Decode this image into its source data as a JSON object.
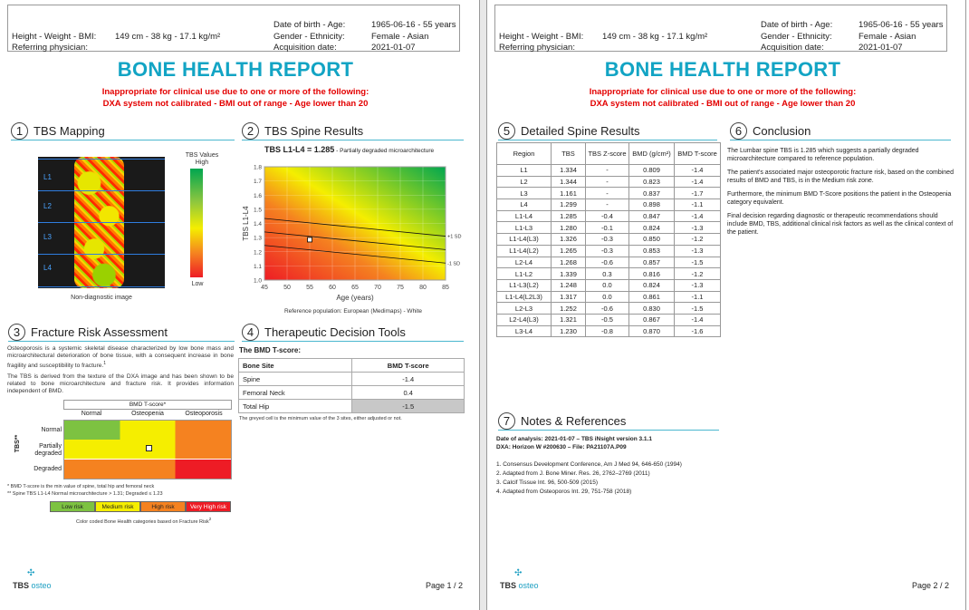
{
  "header": {
    "height_weight_bmi_label": "Height - Weight - BMI:",
    "height_weight_bmi_value": "149 cm - 38 kg - 17.1 kg/m²",
    "referring_physician_label": "Referring physician:",
    "dob_age_label": "Date of birth - Age:",
    "dob_age_value": "1965-06-16 - 55 years",
    "gender_ethnicity_label": "Gender - Ethnicity:",
    "gender_ethnicity_value": "Female - Asian",
    "acquisition_date_label": "Acquisition date:",
    "acquisition_date_value": "2021-01-07"
  },
  "report_title": "BONE HEALTH REPORT",
  "warning_line1": "Inappropriate for clinical use due to one or more of the following:",
  "warning_line2": "DXA system not calibrated - BMI out of range - Age lower than 20",
  "sections": {
    "s1": {
      "num": "1",
      "title": "TBS Mapping"
    },
    "s2": {
      "num": "2",
      "title": "TBS Spine Results"
    },
    "s3": {
      "num": "3",
      "title": "Fracture Risk Assessment"
    },
    "s4": {
      "num": "4",
      "title": "Therapeutic Decision Tools"
    },
    "s5": {
      "num": "5",
      "title": "Detailed Spine Results"
    },
    "s6": {
      "num": "6",
      "title": "Conclusion"
    },
    "s7": {
      "num": "7",
      "title": "Notes & References"
    }
  },
  "tbs_mapping": {
    "legend_title": "TBS Values",
    "legend_high": "High",
    "legend_low": "Low",
    "vertebrae": [
      "L1",
      "L2",
      "L3",
      "L4"
    ],
    "caption": "Non-diagnostic image"
  },
  "tbs_spine": {
    "headline": "TBS L1-L4 = 1.285",
    "headline_note": " - Partially degraded microarchitecture",
    "ref_caption": "Reference population: European (Medimaps) - White"
  },
  "chart_data": {
    "type": "line",
    "xlabel": "Age (years)",
    "ylabel": "TBS L1-L4",
    "xlim": [
      45,
      85
    ],
    "ylim": [
      1.0,
      1.8
    ],
    "xticks": [
      45,
      50,
      55,
      60,
      65,
      70,
      75,
      80,
      85
    ],
    "yticks": [
      1.0,
      1.1,
      1.2,
      1.3,
      1.4,
      1.5,
      1.6,
      1.7,
      1.8
    ],
    "series": [
      {
        "name": "+1 SD",
        "x": [
          45,
          85
        ],
        "y": [
          1.435,
          1.31
        ]
      },
      {
        "name": "",
        "x": [
          45,
          85
        ],
        "y": [
          1.34,
          1.215
        ]
      },
      {
        "name": "-1 SD",
        "x": [
          45,
          85
        ],
        "y": [
          1.245,
          1.12
        ]
      }
    ],
    "patient_point": {
      "x": 55,
      "y": 1.285
    },
    "grid": true
  },
  "fracture_risk": {
    "para1": "Osteoporosis is a systemic skeletal disease characterized by low bone mass and microarchitectural deterioration of bone tissue, with a consequent increase in bone fragility and susceptibility to fracture.",
    "para2": "The TBS is derived from the texture of the DXA image and has been shown to be related to bone microarchitecture and fracture risk. It provides information independent of BMD.",
    "grid_title": "BMD T-score*",
    "cols": [
      "Normal",
      "Osteopenia",
      "Osteoporosis"
    ],
    "rows": [
      "Normal",
      "Partially degraded",
      "Degraded"
    ],
    "row_axis": "TBS**",
    "note1": "* BMD T-score is the min value of spine, total hip and femoral neck",
    "note2": "** Spine TBS L1-L4 Normal microarchitecture > 1.31; Degraded ≤ 1.23",
    "legend": [
      "Low risk",
      "Medium risk",
      "High risk",
      "Very High risk"
    ],
    "legend_caption": "Color coded Bone Health categories based on Fracture Risk",
    "colors": {
      "low": "#7dc241",
      "medium": "#f5ee00",
      "high": "#f58220",
      "veryhigh": "#ee1c25"
    }
  },
  "therapeutic": {
    "subtitle": "The BMD T-score:",
    "head": [
      "Bone Site",
      "BMD T-score"
    ],
    "rows": [
      [
        "Spine",
        "-1.4"
      ],
      [
        "Femoral Neck",
        "0.4"
      ],
      [
        "Total Hip",
        "-1.5"
      ]
    ],
    "note": "The greyed cell is the minimum value of the 3 sites, either adjusted or not."
  },
  "detailed": {
    "head": [
      "Region",
      "TBS",
      "TBS Z-score",
      "BMD (g/cm²)",
      "BMD T-score"
    ],
    "rows": [
      [
        "L1",
        "1.334",
        "-",
        "0.809",
        "-1.4"
      ],
      [
        "L2",
        "1.344",
        "-",
        "0.823",
        "-1.4"
      ],
      [
        "L3",
        "1.161",
        "-",
        "0.837",
        "-1.7"
      ],
      [
        "L4",
        "1.299",
        "-",
        "0.898",
        "-1.1"
      ],
      [
        "L1-L4",
        "1.285",
        "-0.4",
        "0.847",
        "-1.4"
      ],
      [
        "L1-L3",
        "1.280",
        "-0.1",
        "0.824",
        "-1.3"
      ],
      [
        "L1-L4(L3)",
        "1.326",
        "-0.3",
        "0.850",
        "-1.2"
      ],
      [
        "L1-L4(L2)",
        "1.265",
        "-0.3",
        "0.853",
        "-1.3"
      ],
      [
        "L2-L4",
        "1.268",
        "-0.6",
        "0.857",
        "-1.5"
      ],
      [
        "L1-L2",
        "1.339",
        "0.3",
        "0.816",
        "-1.2"
      ],
      [
        "L1-L3(L2)",
        "1.248",
        "0.0",
        "0.824",
        "-1.3"
      ],
      [
        "L1-L4(L2L3)",
        "1.317",
        "0.0",
        "0.861",
        "-1.1"
      ],
      [
        "L2-L3",
        "1.252",
        "-0.6",
        "0.830",
        "-1.5"
      ],
      [
        "L2-L4(L3)",
        "1.321",
        "-0.5",
        "0.867",
        "-1.4"
      ],
      [
        "L3-L4",
        "1.230",
        "-0.8",
        "0.870",
        "-1.6"
      ]
    ]
  },
  "conclusion": [
    "The Lumbar spine TBS is 1.285 which suggests a partially degraded microarchitecture compared to reference population.",
    "The patient's associated major osteoporotic fracture risk, based on the combined results of BMD and TBS, is in the Medium risk zone.",
    "Furthermore, the minimum BMD T-Score positions the patient in the Osteopenia category equivalent.",
    "Final decision regarding diagnostic or therapeutic recommendations should include BMD, TBS, additional clinical risk factors as well as the clinical context of the patient."
  ],
  "notes": {
    "analysis": "Date of analysis: 2021-01-07 – TBS iNsight version 3.1.1",
    "dxa": "DXA: Horizon W #200630 – File: PA21107A.P09",
    "refs": [
      "1. Consensus Development Conference, Am J Med 94, 646-650 (1994)",
      "2. Adapted from J. Bone Miner. Res. 26, 2762–2769 (2011)",
      "3. Calcif Tissue Int. 96, 500-509 (2015)",
      "4. Adapted from Osteoporos Int. 29, 751-758 (2018)"
    ]
  },
  "footer": {
    "logo_tbs": "TBS",
    "logo_osteo": "osteo",
    "page1": "Page 1 / 2",
    "page2": "Page 2 / 2"
  }
}
